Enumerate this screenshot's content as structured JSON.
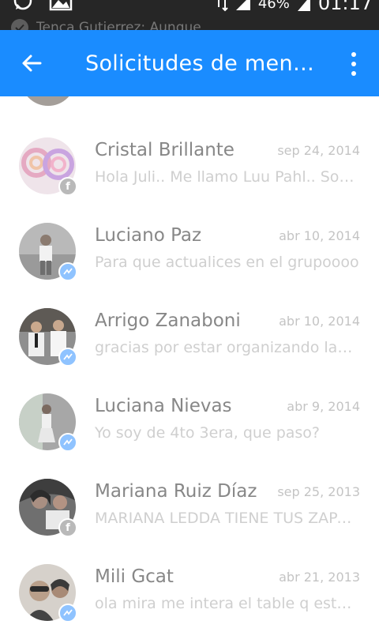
{
  "status_bar": {
    "notification_text": "Tenca Gutierrez: Aunque",
    "battery": "46%",
    "time": "01:17"
  },
  "header": {
    "title": "Solicitudes de mens...",
    "back_icon": "arrow-left-icon",
    "menu_icon": "more-vert-icon"
  },
  "colors": {
    "app_bar": "#1a8cff",
    "messenger_badge": "#8fc3ff",
    "facebook_badge": "#b9b9b9"
  },
  "conversations": [
    {
      "name": "Cristal Brillante",
      "date": "sep 24, 2014",
      "snippet": "Hola Juli.. Me llamo Luu Pahl.. Soy mama de…",
      "badge": "facebook"
    },
    {
      "name": "Luciano Paz",
      "date": "abr 10, 2014",
      "snippet": "Para que actualices en el grupoooo",
      "badge": "messenger"
    },
    {
      "name": "Arrigo Zanaboni",
      "date": "abr 10, 2014",
      "snippet": "gracias por estar organizando las cosas",
      "badge": "messenger"
    },
    {
      "name": "Luciana Nievas",
      "date": "abr 9, 2014",
      "snippet": "Yo soy de 4to 3era, que paso?",
      "badge": "messenger"
    },
    {
      "name": "Mariana Ruiz Díaz",
      "date": "sep 25, 2013",
      "snippet": "MARIANA LEDDA TIENE TUS ZAPATILLAS",
      "badge": "facebook"
    },
    {
      "name": "Mili Gcat",
      "date": "abr 21, 2013",
      "snippet": "ola mira me intera el table q estas vendiendo",
      "badge": "messenger"
    }
  ]
}
